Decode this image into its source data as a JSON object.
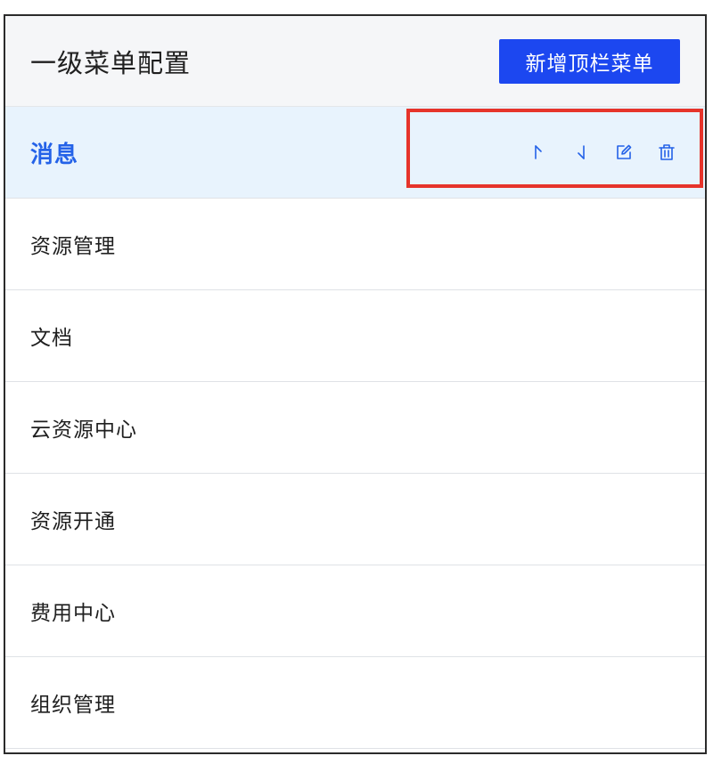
{
  "header": {
    "title": "一级菜单配置",
    "add_button_label": "新增顶栏菜单"
  },
  "menu": {
    "items": [
      {
        "label": "消息",
        "active": true
      },
      {
        "label": "资源管理",
        "active": false
      },
      {
        "label": "文档",
        "active": false
      },
      {
        "label": "云资源中心",
        "active": false
      },
      {
        "label": "资源开通",
        "active": false
      },
      {
        "label": "费用中心",
        "active": false
      },
      {
        "label": "组织管理",
        "active": false
      }
    ],
    "actions": [
      {
        "icon": "move-up-icon"
      },
      {
        "icon": "move-down-icon"
      },
      {
        "icon": "edit-icon"
      },
      {
        "icon": "delete-icon"
      }
    ]
  },
  "colors": {
    "accent": "#1c47f0",
    "active_text": "#2462e8",
    "active_bg": "#e8f3fd",
    "highlight": "#e6342b"
  }
}
